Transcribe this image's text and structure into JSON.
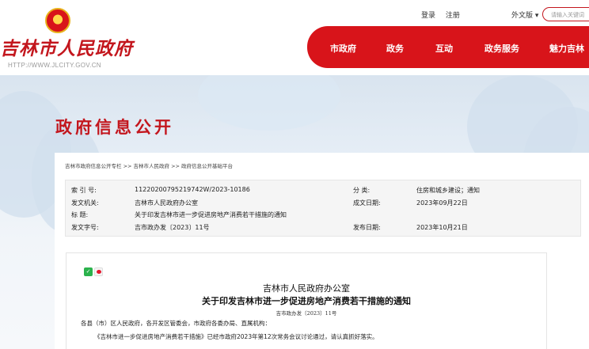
{
  "header": {
    "logo_text": "吉林市人民政府",
    "logo_url": "HTTP://WWW.JLCITY.GOV.CN",
    "login": "登录",
    "register": "注册",
    "language": "外文版 ▾",
    "search_placeholder": "请输入关键词",
    "nav": [
      "市政府",
      "政务",
      "互动",
      "政务服务",
      "魅力吉林"
    ]
  },
  "section_title": "政府信息公开",
  "breadcrumb": "吉林市政府信息公开专栏 >> 吉林市人民政府 >> 政府信息公开基础平台",
  "meta": {
    "index_label": "索 引 号:",
    "index_value": "11220200795219742W/2023-10186",
    "category_label": "分    类:",
    "category_value": "住房和城乡建设；通知",
    "issuer_label": "发文机关:",
    "issuer_value": "吉林市人民政府办公室",
    "written_label": "成文日期:",
    "written_value": "2023年09月22日",
    "title_label": "标      题:",
    "title_value": "关于印发吉林市进一步促进房地产消费若干措施的通知",
    "docno_label": "发文字号:",
    "docno_value": "吉市政办发〔2023〕11号",
    "published_label": "发布日期:",
    "published_value": "2023年10月21日"
  },
  "document": {
    "org": "吉林市人民政府办公室",
    "title": "关于印发吉林市进一步促进房地产消费若干措施的通知",
    "number": "吉市政办发〔2023〕11号",
    "para1": "各县（市）区人民政府，各开发区管委会，市政府各委办局、直属机构：",
    "para2": "《吉林市进一步促进房地产消费若干措施》已经市政府2023年第12次常务会议讨论通过，请认真抓好落实。"
  },
  "colors": {
    "brand_red": "#d8141a",
    "title_red": "#c3161d"
  }
}
